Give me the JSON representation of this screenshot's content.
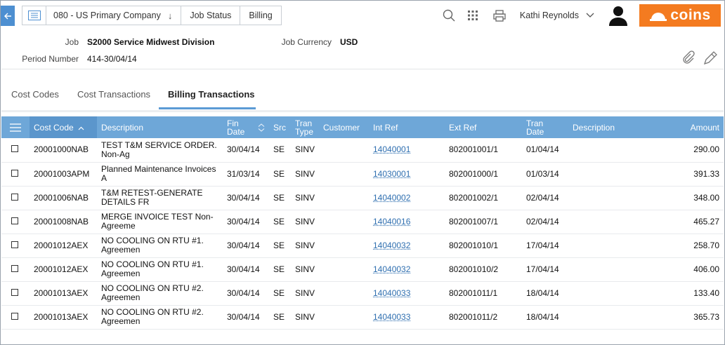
{
  "breadcrumb": {
    "company": "080 - US Primary Company",
    "job_status": "Job Status",
    "billing": "Billing"
  },
  "user": {
    "name": "Kathi Reynolds"
  },
  "brand": {
    "logo_text": "coins",
    "color": "#f47b20"
  },
  "header": {
    "job_label": "Job",
    "job_value": "S2000 Service Midwest Division",
    "period_label": "Period Number",
    "period_value": "414-30/04/14",
    "currency_label": "Job Currency",
    "currency_value": "USD"
  },
  "tabs": [
    {
      "label": "Cost Codes"
    },
    {
      "label": "Cost Transactions"
    },
    {
      "label": "Billing Transactions"
    }
  ],
  "table": {
    "columns": {
      "cost_code": "Cost Code",
      "description": "Description",
      "fin_date_1": "Fin",
      "fin_date_2": "Date",
      "src": "Src",
      "tran_type_1": "Tran",
      "tran_type_2": "Type",
      "customer": "Customer",
      "int_ref": "Int Ref",
      "ext_ref": "Ext Ref",
      "tran_date_1": "Tran",
      "tran_date_2": "Date",
      "description2": "Description",
      "amount": "Amount"
    },
    "rows": [
      {
        "cost_code": "20001000NAB",
        "desc_1": "TEST T&M SERVICE ORDER.",
        "desc_2": "Non-Ag",
        "fin_date": "30/04/14",
        "src": "SE",
        "tran_type": "SINV",
        "customer": "",
        "int_ref": "14040001",
        "ext_ref": "802001001/1",
        "tran_date": "01/04/14",
        "description2": "",
        "amount": "290.00"
      },
      {
        "cost_code": "20001003APM",
        "desc_1": "Planned Maintenance Invoices",
        "desc_2": "A",
        "fin_date": "31/03/14",
        "src": "SE",
        "tran_type": "SINV",
        "customer": "",
        "int_ref": "14030001",
        "ext_ref": "802001000/1",
        "tran_date": "01/03/14",
        "description2": "",
        "amount": "391.33"
      },
      {
        "cost_code": "20001006NAB",
        "desc_1": "T&M RETEST-GENERATE",
        "desc_2": "DETAILS FR",
        "fin_date": "30/04/14",
        "src": "SE",
        "tran_type": "SINV",
        "customer": "",
        "int_ref": "14040002",
        "ext_ref": "802001002/1",
        "tran_date": "02/04/14",
        "description2": "",
        "amount": "348.00"
      },
      {
        "cost_code": "20001008NAB",
        "desc_1": "MERGE INVOICE TEST Non-",
        "desc_2": "Agreeme",
        "fin_date": "30/04/14",
        "src": "SE",
        "tran_type": "SINV",
        "customer": "",
        "int_ref": "14040016",
        "ext_ref": "802001007/1",
        "tran_date": "02/04/14",
        "description2": "",
        "amount": "465.27"
      },
      {
        "cost_code": "20001012AEX",
        "desc_1": "NO COOLING ON RTU #1.",
        "desc_2": "Agreemen",
        "fin_date": "30/04/14",
        "src": "SE",
        "tran_type": "SINV",
        "customer": "",
        "int_ref": "14040032",
        "ext_ref": "802001010/1",
        "tran_date": "17/04/14",
        "description2": "",
        "amount": "258.70"
      },
      {
        "cost_code": "20001012AEX",
        "desc_1": "NO COOLING ON RTU #1.",
        "desc_2": "Agreemen",
        "fin_date": "30/04/14",
        "src": "SE",
        "tran_type": "SINV",
        "customer": "",
        "int_ref": "14040032",
        "ext_ref": "802001010/2",
        "tran_date": "17/04/14",
        "description2": "",
        "amount": "406.00"
      },
      {
        "cost_code": "20001013AEX",
        "desc_1": "NO COOLING ON RTU #2.",
        "desc_2": "Agreemen",
        "fin_date": "30/04/14",
        "src": "SE",
        "tran_type": "SINV",
        "customer": "",
        "int_ref": "14040033",
        "ext_ref": "802001011/1",
        "tran_date": "18/04/14",
        "description2": "",
        "amount": "133.40"
      },
      {
        "cost_code": "20001013AEX",
        "desc_1": "NO COOLING ON RTU #2.",
        "desc_2": "Agreemen",
        "fin_date": "30/04/14",
        "src": "SE",
        "tran_type": "SINV",
        "customer": "",
        "int_ref": "14040033",
        "ext_ref": "802001011/2",
        "tran_date": "18/04/14",
        "description2": "",
        "amount": "365.73"
      }
    ]
  },
  "icons": {
    "back": "arrow-left-icon",
    "menu": "list-icon",
    "search": "search-icon",
    "apps": "grid-icon",
    "print": "printer-icon",
    "chevron": "chevron-down-icon",
    "avatar": "avatar-icon",
    "attach": "paperclip-icon",
    "edit": "pen-icon"
  }
}
